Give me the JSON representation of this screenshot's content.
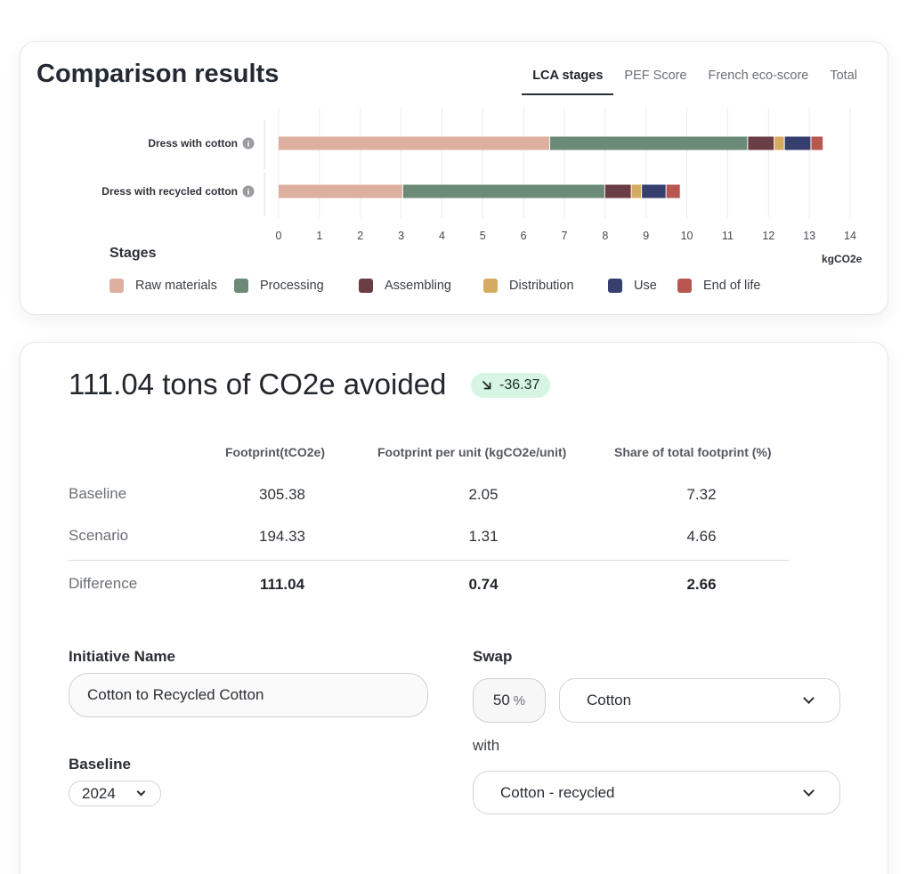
{
  "comparison": {
    "title": "Comparison results",
    "tabs": [
      {
        "label": "LCA stages",
        "active": true
      },
      {
        "label": "PEF Score",
        "active": false
      },
      {
        "label": "French eco-score",
        "active": false
      },
      {
        "label": "Total",
        "active": false
      }
    ],
    "stages_title": "Stages",
    "unit_label": "kgCO2e",
    "info_icon": "info-icon"
  },
  "chart_data": {
    "type": "bar",
    "orientation": "horizontal",
    "stacked": true,
    "categories": [
      "Dress with cotton",
      "Dress with recycled cotton"
    ],
    "series": [
      {
        "name": "Raw materials",
        "color": "#dcaf9f",
        "values": [
          6.65,
          3.05
        ]
      },
      {
        "name": "Processing",
        "color": "#6b8b77",
        "values": [
          4.85,
          4.95
        ]
      },
      {
        "name": "Assembling",
        "color": "#6b3d44",
        "values": [
          0.65,
          0.65
        ]
      },
      {
        "name": "Distribution",
        "color": "#d5ab62",
        "values": [
          0.25,
          0.25
        ]
      },
      {
        "name": "Use",
        "color": "#363f6d",
        "values": [
          0.65,
          0.6
        ]
      },
      {
        "name": "End of life",
        "color": "#b85650",
        "values": [
          0.3,
          0.35
        ]
      }
    ],
    "xticks": [
      0,
      1,
      2,
      3,
      4,
      5,
      6,
      7,
      8,
      9,
      10,
      11,
      12,
      13,
      14
    ],
    "xlim": [
      0,
      14
    ],
    "xlabel": "kgCO2e",
    "grid": true,
    "legend_position": "bottom"
  },
  "scenario": {
    "title": "111.04 tons of CO2e avoided",
    "badge": {
      "icon": "arrow-down-right-icon",
      "value": "-36.37",
      "bg": "#d6f5e3"
    },
    "table": {
      "headers": [
        "Footprint(tCO2e)",
        "Footprint per unit (kgCO2e/unit)",
        "Share of total footprint (%)"
      ],
      "rows": [
        {
          "label": "Baseline",
          "values": [
            "305.38",
            "2.05",
            "7.32"
          ],
          "bold": false
        },
        {
          "label": "Scenario",
          "values": [
            "194.33",
            "1.31",
            "4.66"
          ],
          "bold": false
        },
        {
          "label": "Difference",
          "values": [
            "111.04",
            "0.74",
            "2.66"
          ],
          "bold": true
        }
      ]
    },
    "form": {
      "initiative_label": "Initiative Name",
      "initiative_value": "Cotton to Recycled Cotton",
      "swap_label": "Swap",
      "swap_percent": "50",
      "percent_sign": "%",
      "swap_from": "Cotton",
      "with_label": "with",
      "swap_to": "Cotton - recycled",
      "baseline_label": "Baseline",
      "baseline_year": "2024"
    }
  }
}
